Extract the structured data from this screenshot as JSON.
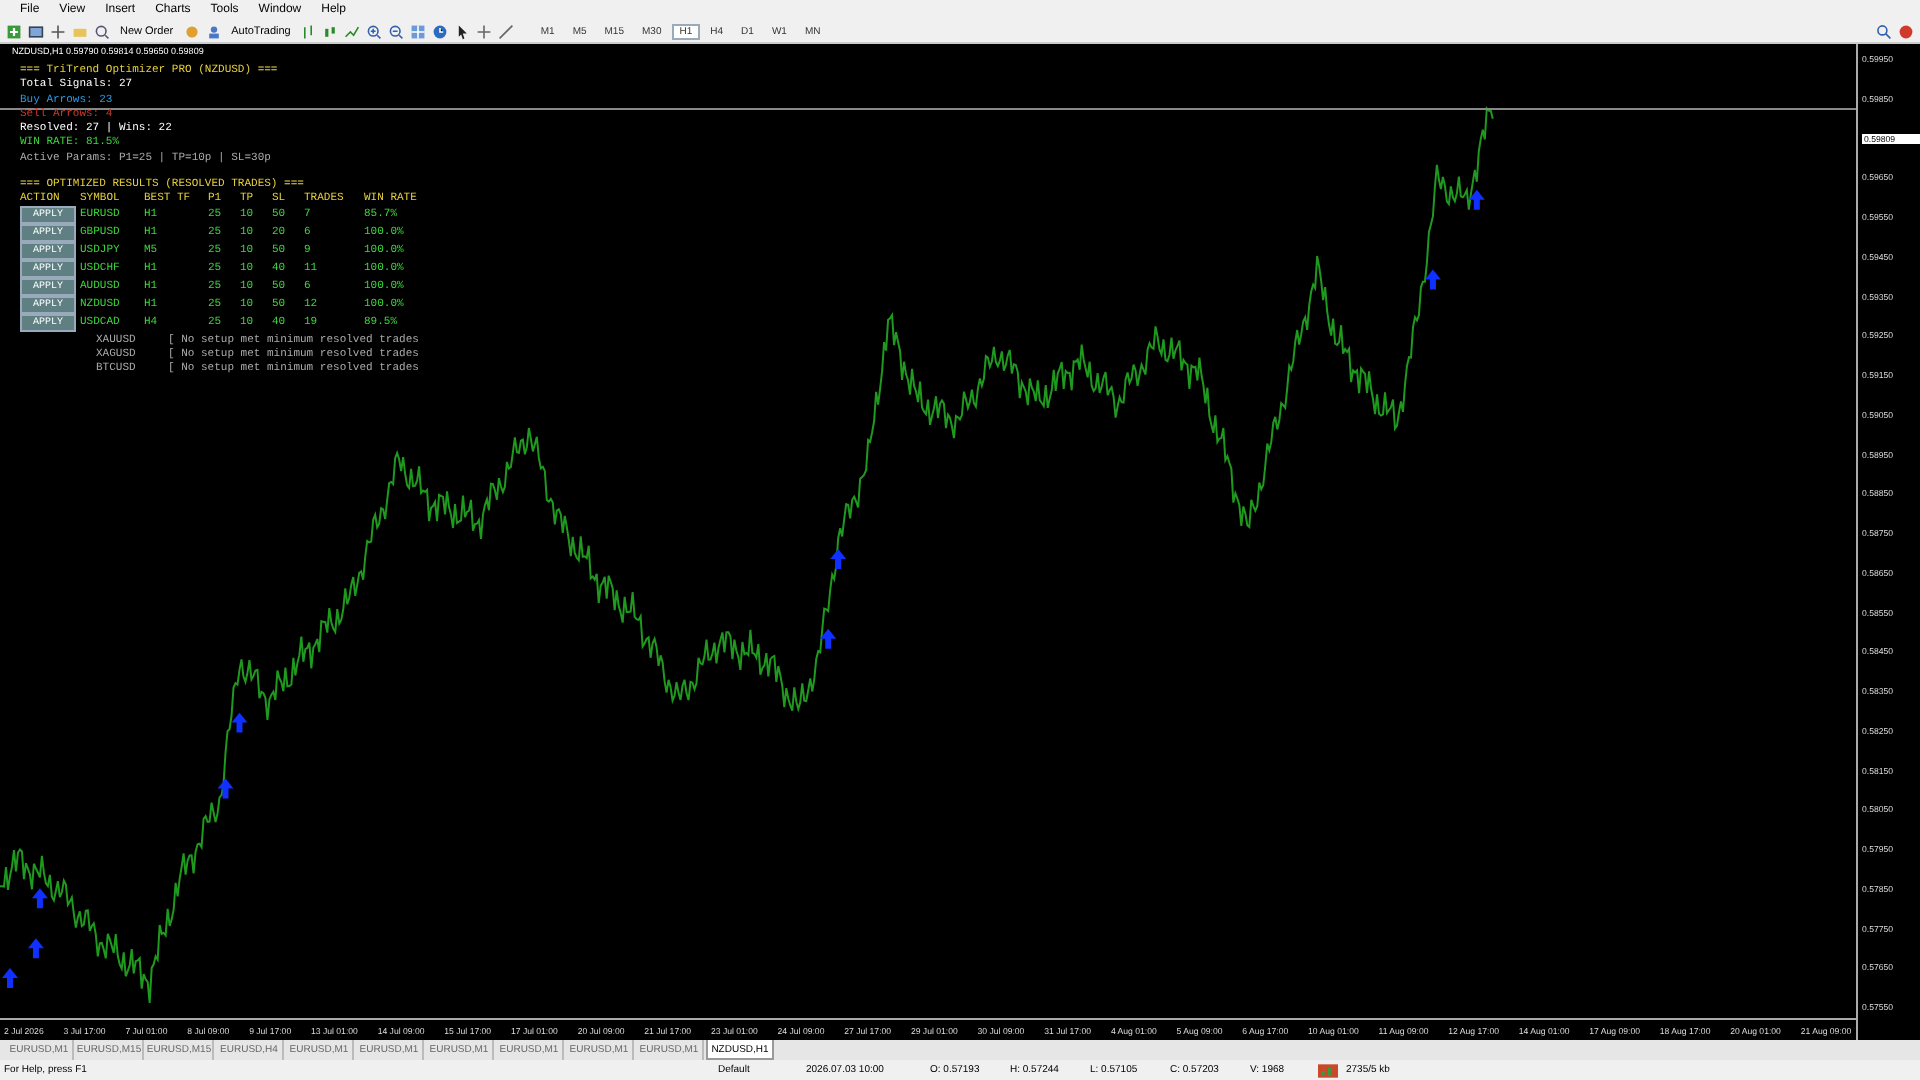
{
  "menu": [
    "File",
    "View",
    "Insert",
    "Charts",
    "Tools",
    "Window",
    "Help"
  ],
  "toolbar": {
    "new_order": "New Order",
    "autotrading": "AutoTrading",
    "timeframes": [
      {
        "label": "M1",
        "selected": false
      },
      {
        "label": "M5",
        "selected": false
      },
      {
        "label": "M15",
        "selected": false
      },
      {
        "label": "M30",
        "selected": false
      },
      {
        "label": "H1",
        "selected": true
      },
      {
        "label": "H4",
        "selected": false
      },
      {
        "label": "D1",
        "selected": false
      },
      {
        "label": "W1",
        "selected": false
      },
      {
        "label": "MN",
        "selected": false
      }
    ]
  },
  "chart": {
    "title": "NZDUSD,H1  0.59790 0.59814 0.59650 0.59809",
    "current_price": "0.59809",
    "price_labels": [
      "0.59950",
      "0.59850",
      "0.59650",
      "0.59550",
      "0.59450",
      "0.59350",
      "0.59250",
      "0.59150",
      "0.59050",
      "0.58950",
      "0.58850",
      "0.58750",
      "0.58650",
      "0.58550",
      "0.58450",
      "0.58350",
      "0.58250",
      "0.58150",
      "0.58050",
      "0.57950",
      "0.57850",
      "0.57750",
      "0.57650",
      "0.57550"
    ],
    "time_labels": [
      "2 Jul 2026",
      "3 Jul 17:00",
      "7 Jul 01:00",
      "8 Jul 09:00",
      "9 Jul 17:00",
      "13 Jul 01:00",
      "14 Jul 09:00",
      "15 Jul 17:00",
      "17 Jul 01:00",
      "20 Jul 09:00",
      "21 Jul 17:00",
      "23 Jul 01:00",
      "24 Jul 09:00",
      "27 Jul 17:00",
      "29 Jul 01:00",
      "30 Jul 09:00",
      "31 Jul 17:00",
      "4 Aug 01:00",
      "5 Aug 09:00",
      "6 Aug 17:00",
      "10 Aug 01:00",
      "11 Aug 09:00",
      "12 Aug 17:00",
      "14 Aug 01:00",
      "17 Aug 09:00",
      "18 Aug 17:00",
      "20 Aug 01:00",
      "21 Aug 09:00"
    ]
  },
  "panel": {
    "title": "=== TriTrend Optimizer PRO (NZDUSD) ===",
    "total": "Total Signals: 27",
    "buy": "Buy Arrows: 23",
    "sell": "Sell Arrows: 4",
    "resolved": "Resolved: 27 | Wins: 22",
    "win_rate": "WIN RATE: 81.5%",
    "params": "Active Params: P1=25 | TP=10p | SL=30p",
    "results_title": "=== OPTIMIZED RESULTS (RESOLVED TRADES) ===",
    "columns": [
      "ACTION",
      "SYMBOL",
      "BEST TF",
      "P1",
      "TP",
      "SL",
      "TRADES",
      "WIN RATE"
    ],
    "rows": [
      {
        "cells": [
          "APPLY",
          "EURUSD",
          "H1",
          "25",
          "10",
          "50",
          "7",
          "85.7%"
        ]
      },
      {
        "cells": [
          "APPLY",
          "GBPUSD",
          "H1",
          "25",
          "10",
          "20",
          "6",
          "100.0%"
        ]
      },
      {
        "cells": [
          "APPLY",
          "USDJPY",
          "M5",
          "25",
          "10",
          "50",
          "9",
          "100.0%"
        ]
      },
      {
        "cells": [
          "APPLY",
          "USDCHF",
          "H1",
          "25",
          "10",
          "40",
          "11",
          "100.0%"
        ]
      },
      {
        "cells": [
          "APPLY",
          "AUDUSD",
          "H1",
          "25",
          "10",
          "50",
          "6",
          "100.0%"
        ]
      },
      {
        "cells": [
          "APPLY",
          "NZDUSD",
          "H1",
          "25",
          "10",
          "50",
          "12",
          "100.0%"
        ]
      },
      {
        "cells": [
          "APPLY",
          "USDCAD",
          "H4",
          "25",
          "10",
          "40",
          "19",
          "89.5%"
        ]
      }
    ],
    "no_setup": [
      {
        "symbol": "XAUUSD",
        "note": "[ No setup met minimum resolved trades"
      },
      {
        "symbol": "XAGUSD",
        "note": "[ No setup met minimum resolved trades"
      },
      {
        "symbol": "BTCUSD",
        "note": "[ No setup met minimum resolved trades"
      }
    ]
  },
  "tabs": [
    {
      "label": "EURUSD,M1",
      "selected": false
    },
    {
      "label": "EURUSD,M15",
      "selected": false
    },
    {
      "label": "EURUSD,M15",
      "selected": false
    },
    {
      "label": "EURUSD,H4",
      "selected": false
    },
    {
      "label": "EURUSD,M1",
      "selected": false
    },
    {
      "label": "EURUSD,M1",
      "selected": false
    },
    {
      "label": "EURUSD,M1",
      "selected": false
    },
    {
      "label": "EURUSD,M1",
      "selected": false
    },
    {
      "label": "EURUSD,M1",
      "selected": false
    },
    {
      "label": "EURUSD,M1",
      "selected": false
    },
    {
      "label": "NZDUSD,H1",
      "selected": true
    }
  ],
  "status_bar": {
    "help": "For Help, press F1",
    "profile": "Default",
    "time": "2026.07.03 10:00",
    "open": "O: 0.57193",
    "high": "H: 0.57244",
    "low": "L: 0.57105",
    "close": "C: 0.57203",
    "volume": "V: 1968",
    "traffic": "2735/5 kb"
  }
}
